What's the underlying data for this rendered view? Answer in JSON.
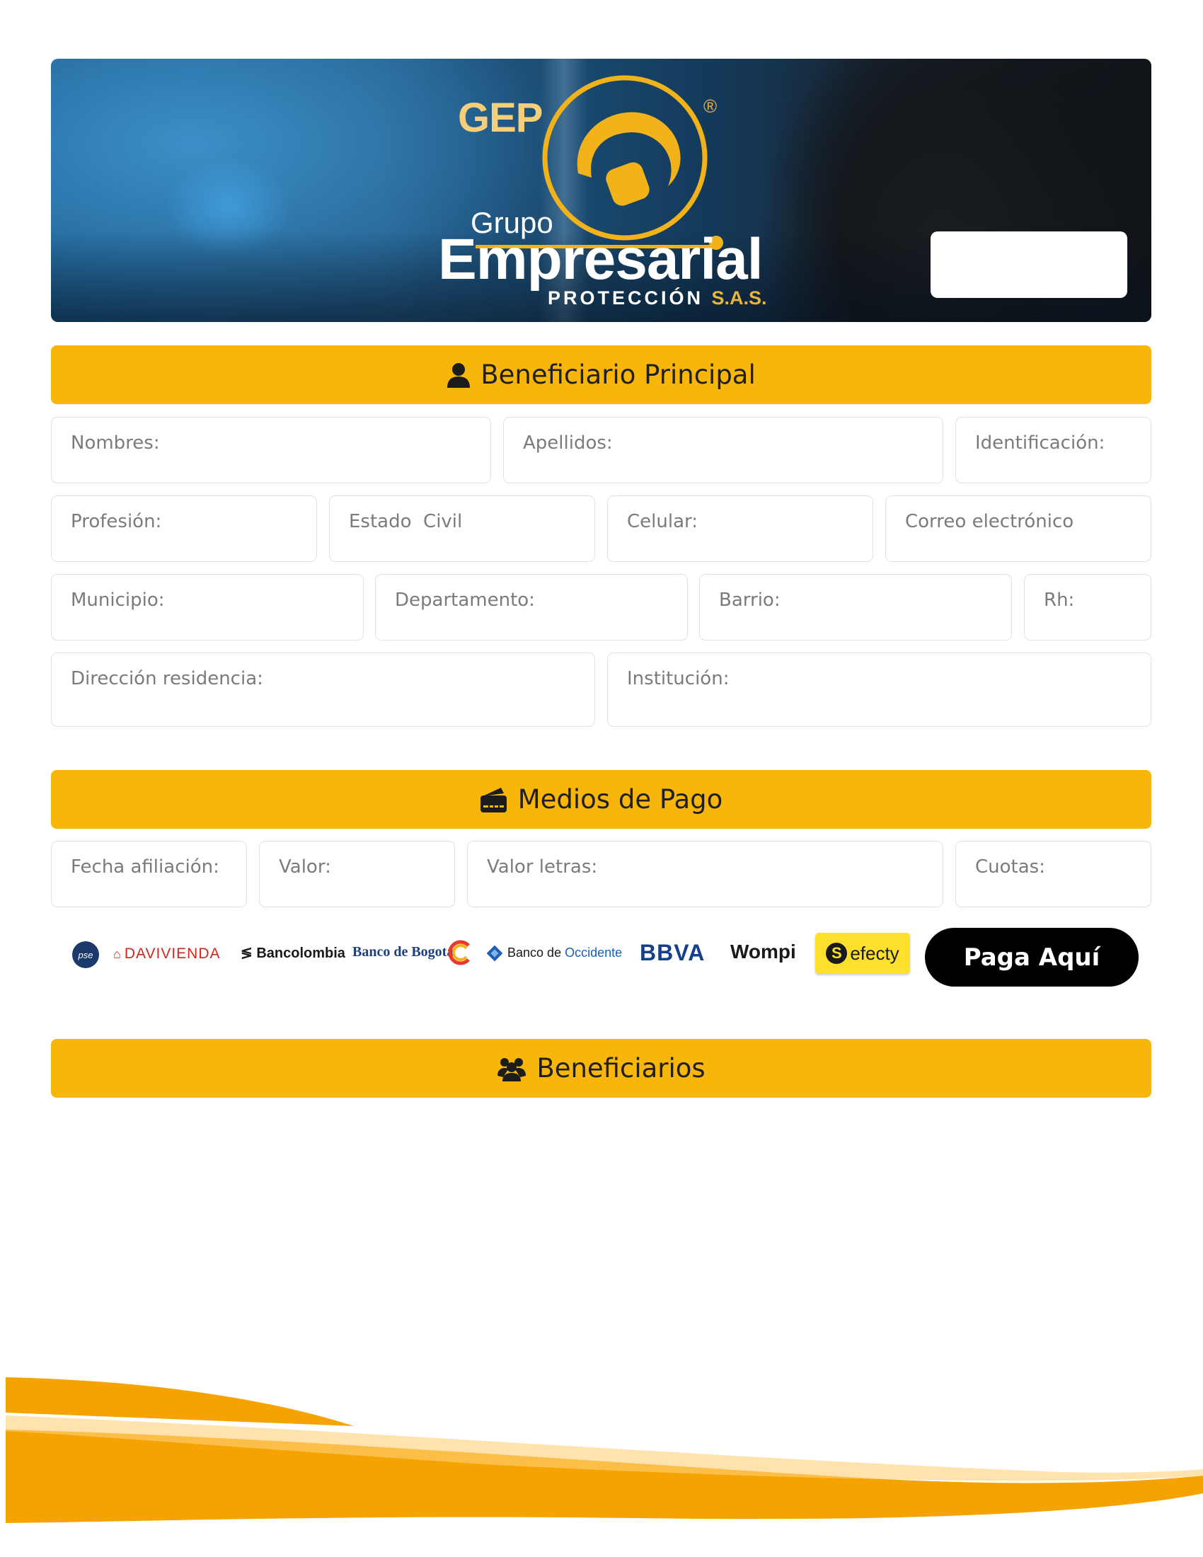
{
  "header": {
    "logo_gep": "GEP",
    "logo_registered": "®",
    "logo_grupo": "Grupo",
    "logo_empresarial": "Empresarial",
    "logo_proteccion": "PROTECCIÓN",
    "logo_sas": "S.A.S."
  },
  "sections": {
    "principal": {
      "title": "Beneficiario Principal",
      "icon": "user-icon"
    },
    "pago": {
      "title": "Medios de Pago",
      "icon": "wallet-icon"
    },
    "beneficiarios": {
      "title": "Beneficiarios",
      "icon": "users-icon"
    }
  },
  "principal_fields": {
    "nombres": "Nombres:",
    "apellidos": "Apellidos:",
    "identificacion": "Identificación:",
    "profesion": "Profesión:",
    "estado_civil": "Estado  Civil",
    "celular": "Celular:",
    "correo": "Correo electrónico",
    "municipio": "Municipio:",
    "departamento": "Departamento:",
    "barrio": "Barrio:",
    "rh": "Rh:",
    "direccion": "Dirección residencia:",
    "institucion": "Institución:"
  },
  "payment_fields": {
    "fecha": "Fecha afiliación:",
    "valor": "Valor:",
    "valor_letras": "Valor letras:",
    "cuotas": "Cuotas:"
  },
  "payment_logos": {
    "pse": "pse",
    "davivienda": "DAVIVIENDA",
    "bancolombia": "Bancolombia",
    "bogota": "Banco de Bogotá",
    "occidente_prefix": "Banco de ",
    "occidente": "Occidente",
    "bbva": "BBVA",
    "wompi": "Wompi",
    "efecty_mark": "S",
    "efecty": "efecty"
  },
  "pay_button_label": "Paga Aquí",
  "colors": {
    "section_bar": "#f7b609",
    "button": "#000000",
    "wave": "#f5a300"
  }
}
